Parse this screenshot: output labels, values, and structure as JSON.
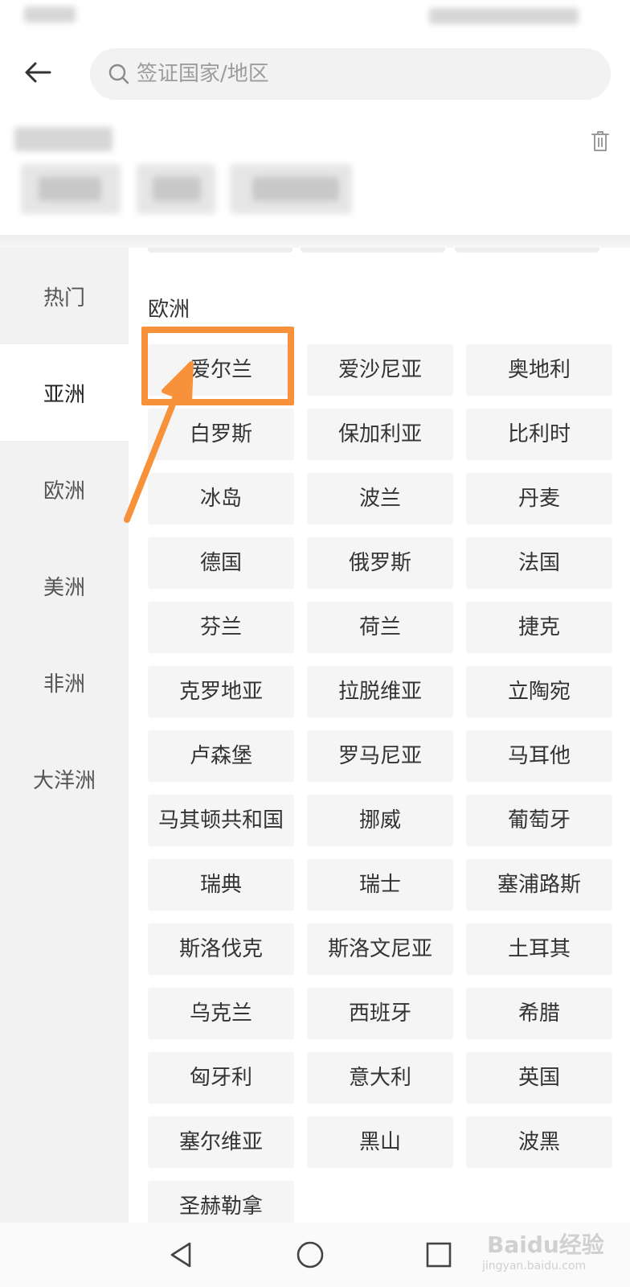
{
  "search": {
    "placeholder": "签证国家/地区"
  },
  "sidebar": {
    "items": [
      {
        "label": "热门"
      },
      {
        "label": "亚洲",
        "active": true
      },
      {
        "label": "欧洲"
      },
      {
        "label": "美洲"
      },
      {
        "label": "非洲"
      },
      {
        "label": "大洋洲"
      }
    ]
  },
  "content": {
    "section_title": "欧洲",
    "countries": [
      "爱尔兰",
      "爱沙尼亚",
      "奥地利",
      "白罗斯",
      "保加利亚",
      "比利时",
      "冰岛",
      "波兰",
      "丹麦",
      "德国",
      "俄罗斯",
      "法国",
      "芬兰",
      "荷兰",
      "捷克",
      "克罗地亚",
      "拉脱维亚",
      "立陶宛",
      "卢森堡",
      "罗马尼亚",
      "马耳他",
      "马其顿共和国",
      "挪威",
      "葡萄牙",
      "瑞典",
      "瑞士",
      "塞浦路斯",
      "斯洛伐克",
      "斯洛文尼亚",
      "土耳其",
      "乌克兰",
      "西班牙",
      "希腊",
      "匈牙利",
      "意大利",
      "英国",
      "塞尔维亚",
      "黑山",
      "波黑",
      "圣赫勒拿"
    ]
  },
  "annotation": {
    "color": "#f7923a"
  },
  "watermark": {
    "main": "Baidu经验",
    "sub": "jingyan.baidu.com"
  }
}
